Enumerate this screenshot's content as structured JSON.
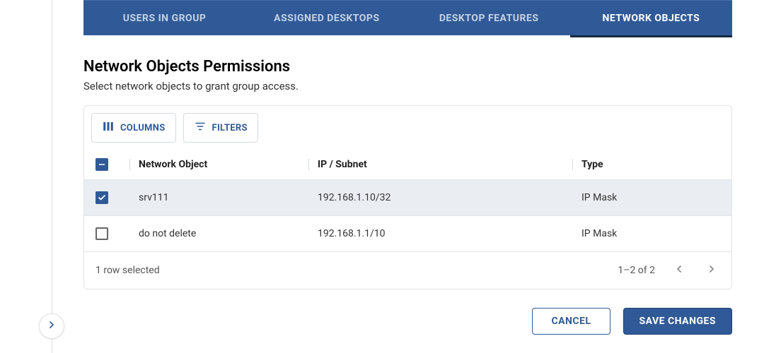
{
  "tabs": [
    {
      "label": "USERS IN GROUP",
      "active": false
    },
    {
      "label": "ASSIGNED DESKTOPS",
      "active": false
    },
    {
      "label": "DESKTOP FEATURES",
      "active": false
    },
    {
      "label": "NETWORK OBJECTS",
      "active": true
    }
  ],
  "section": {
    "title": "Network Objects Permissions",
    "subtitle": "Select network objects to grant group access."
  },
  "toolbar": {
    "columns_label": "COLUMNS",
    "filters_label": "FILTERS"
  },
  "table": {
    "headers": {
      "network_object": "Network Object",
      "ip_subnet": "IP / Subnet",
      "type": "Type"
    },
    "rows": [
      {
        "selected": true,
        "name": "srv111",
        "ip": "192.168.1.10/32",
        "type": "IP Mask"
      },
      {
        "selected": false,
        "name": "do not delete",
        "ip": "192.168.1.1/10",
        "type": "IP Mask"
      }
    ],
    "footer": {
      "selected_text": "1 row selected",
      "range_text": "1–2 of 2"
    }
  },
  "actions": {
    "cancel": "CANCEL",
    "save": "SAVE CHANGES"
  }
}
